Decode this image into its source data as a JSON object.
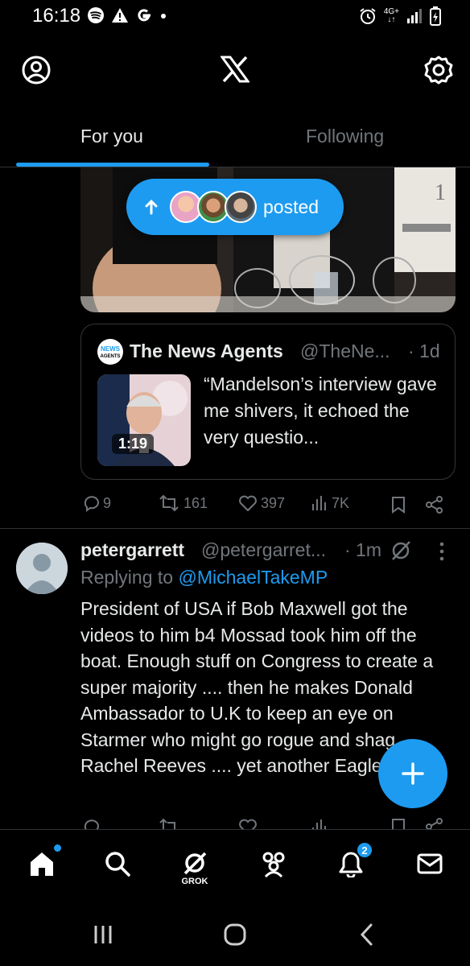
{
  "status_bar": {
    "time": "16:18",
    "network": "4G+",
    "icons": [
      "spotify-icon",
      "warning-icon",
      "google-icon",
      "dot-icon",
      "alarm-icon",
      "signal-icon",
      "battery-icon"
    ]
  },
  "header": {
    "icons": [
      "profile-icon",
      "x-logo-icon",
      "settings-icon"
    ]
  },
  "tabs": {
    "for_you": "For you",
    "following": "Following",
    "active": "For you"
  },
  "new_posts_pill": {
    "label": "posted"
  },
  "post1": {
    "quote": {
      "name": "The News Agents",
      "handle": "@TheNe...",
      "time": "· 1d",
      "text": "“Mandelson’s interview gave me shivers, it echoed the very questio...",
      "video_duration": "1:19"
    },
    "actions": {
      "replies": "9",
      "reposts": "161",
      "likes": "397",
      "views": "7K"
    }
  },
  "post2": {
    "name": "petergarrett",
    "handle": "@petergarret...",
    "time": "· 1m",
    "replying_prefix": "Replying to",
    "replying_to": "@MichaelTakeMP",
    "body": "President of USA if Bob Maxwell got the videos to him b4 Mossad took him off the boat. Enough stuff on Congress to create a super majority .... then he makes Donald Ambassador to U.K to keep an eye on Starmer who might go rogue and shag Rachel Reeves .... yet another Eagle"
  },
  "bottom_nav": {
    "grok_label": "GROK",
    "notifications_badge": "2"
  },
  "colors": {
    "accent": "#1d9bf0",
    "muted": "#71767b",
    "text": "#e7e9ea",
    "divider": "#2f3336"
  }
}
